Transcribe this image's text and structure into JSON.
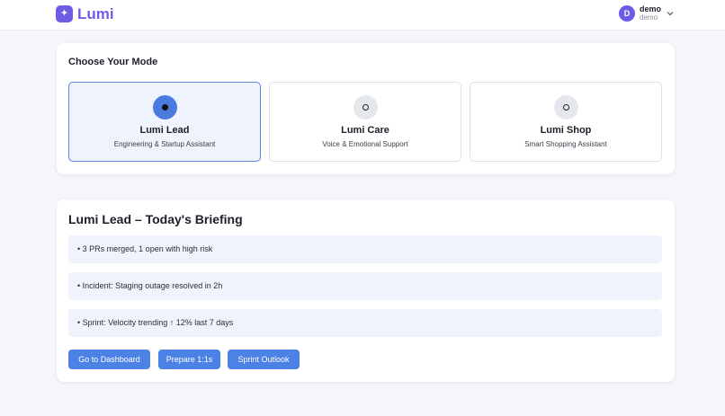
{
  "header": {
    "brand_icon": "sparkle-icon",
    "brand_glyph": "✦",
    "brand_name": "Lumi",
    "user": {
      "avatar_initial": "D",
      "name": "demo",
      "subtitle": "demo"
    }
  },
  "mode_section": {
    "title": "Choose Your Mode",
    "modes": [
      {
        "title": "Lumi Lead",
        "subtitle": "Engineering & Startup Assistant",
        "selected": true
      },
      {
        "title": "Lumi Care",
        "subtitle": "Voice & Emotional Support",
        "selected": false
      },
      {
        "title": "Lumi Shop",
        "subtitle": "Smart Shopping Assistant",
        "selected": false
      }
    ]
  },
  "briefing": {
    "title": "Lumi Lead – Today's Briefing",
    "items": [
      "• 3 PRs merged, 1 open with high risk",
      "• Incident: Staging outage resolved in 2h",
      "• Sprint: Velocity trending ↑ 12% last 7 days"
    ],
    "buttons": {
      "dashboard": "Go to Dashboard",
      "one_on_ones": "Prepare 1:1s",
      "sprint_outlook": "Sprint Outlook"
    }
  },
  "colors": {
    "brand": "#6e5ce6",
    "primary": "#4c82e5",
    "selected_bg": "#eef3fd",
    "item_bg": "#eff3fc"
  }
}
